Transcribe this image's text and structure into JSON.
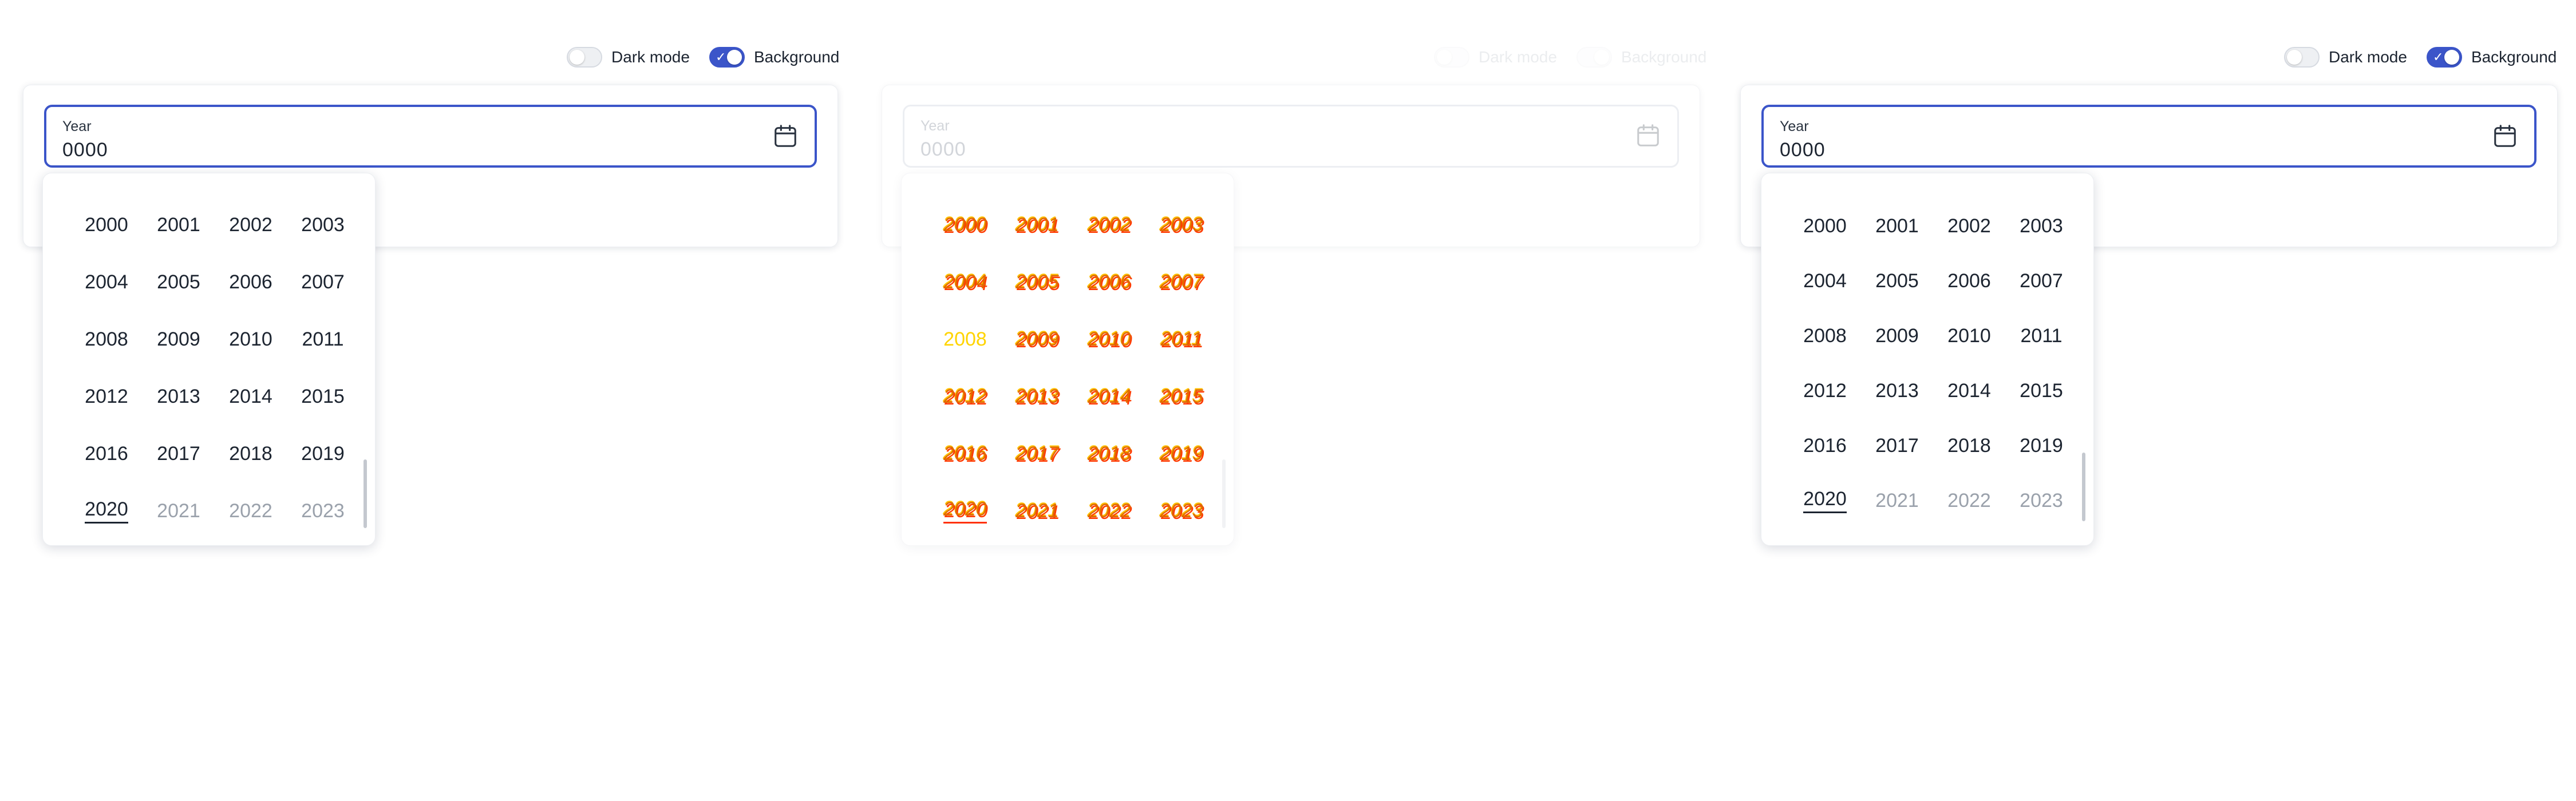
{
  "panels": [
    {
      "toggles": {
        "dark_mode": "Dark mode",
        "background": "Background"
      },
      "field": {
        "label": "Year",
        "value": "0000"
      },
      "years": [
        {
          "text": "2000"
        },
        {
          "text": "2001"
        },
        {
          "text": "2002"
        },
        {
          "text": "2003"
        },
        {
          "text": "2004"
        },
        {
          "text": "2005"
        },
        {
          "text": "2006"
        },
        {
          "text": "2007"
        },
        {
          "text": "2008"
        },
        {
          "text": "2009"
        },
        {
          "text": "2010"
        },
        {
          "text": "2011"
        },
        {
          "text": "2012"
        },
        {
          "text": "2013"
        },
        {
          "text": "2014"
        },
        {
          "text": "2015"
        },
        {
          "text": "2016"
        },
        {
          "text": "2017"
        },
        {
          "text": "2018"
        },
        {
          "text": "2019"
        },
        {
          "text": "2020"
        },
        {
          "text": "2021"
        },
        {
          "text": "2022"
        },
        {
          "text": "2023"
        }
      ]
    },
    {
      "toggles": {
        "dark_mode": "Dark mode",
        "background": "Background"
      },
      "field": {
        "label": "Year",
        "value": "0000"
      },
      "years": [
        {
          "text": "2000"
        },
        {
          "text": "2001"
        },
        {
          "text": "2002"
        },
        {
          "text": "2003"
        },
        {
          "text": "2004"
        },
        {
          "text": "2005"
        },
        {
          "text": "2006"
        },
        {
          "text": "2007"
        },
        {
          "text": "2008"
        },
        {
          "text": "2009"
        },
        {
          "text": "2010"
        },
        {
          "text": "2011"
        },
        {
          "text": "2012"
        },
        {
          "text": "2013"
        },
        {
          "text": "2014"
        },
        {
          "text": "2015"
        },
        {
          "text": "2016"
        },
        {
          "text": "2017"
        },
        {
          "text": "2018"
        },
        {
          "text": "2019"
        },
        {
          "text": "2020"
        },
        {
          "text": "2021"
        },
        {
          "text": "2022"
        },
        {
          "text": "2023"
        }
      ]
    },
    {
      "toggles": {
        "dark_mode": "Dark mode",
        "background": "Background"
      },
      "field": {
        "label": "Year",
        "value": "0000"
      },
      "years": [
        {
          "text": "2000"
        },
        {
          "text": "2001"
        },
        {
          "text": "2002"
        },
        {
          "text": "2003"
        },
        {
          "text": "2004"
        },
        {
          "text": "2005"
        },
        {
          "text": "2006"
        },
        {
          "text": "2007"
        },
        {
          "text": "2008"
        },
        {
          "text": "2009"
        },
        {
          "text": "2010"
        },
        {
          "text": "2011"
        },
        {
          "text": "2012"
        },
        {
          "text": "2013"
        },
        {
          "text": "2014"
        },
        {
          "text": "2015"
        },
        {
          "text": "2016"
        },
        {
          "text": "2017"
        },
        {
          "text": "2018"
        },
        {
          "text": "2019"
        },
        {
          "text": "2020"
        },
        {
          "text": "2021"
        },
        {
          "text": "2022"
        },
        {
          "text": "2023"
        }
      ]
    }
  ],
  "state": {
    "current_year": "2020",
    "disabled_years": [
      "2021",
      "2022",
      "2023"
    ],
    "dark_mode_on": false,
    "background_on": true
  },
  "colors": {
    "accent": "#3b55c9",
    "text": "#1c2430",
    "muted": "#9aa1ab"
  },
  "icons": {
    "field_icon": "calendar-icon",
    "toggle_check": "check-icon"
  }
}
